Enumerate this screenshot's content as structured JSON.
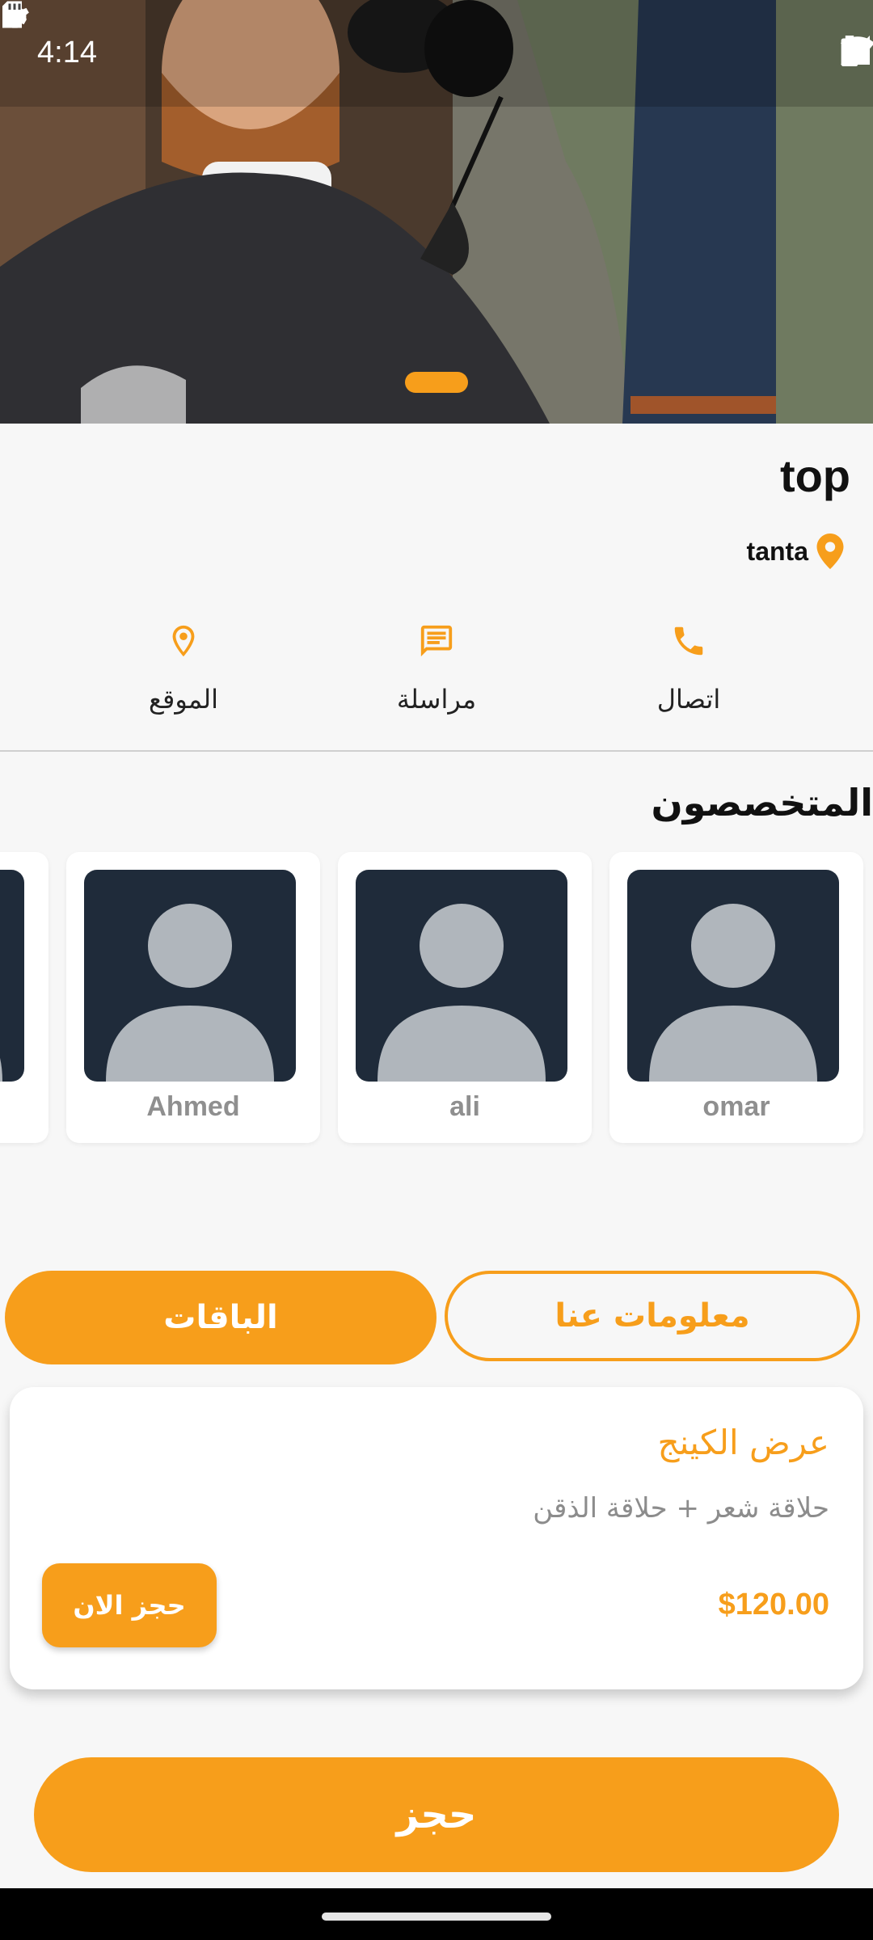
{
  "status_bar": {
    "time": "4:14",
    "icons": [
      "settings-icon",
      "sd-card-icon",
      "wifi-icon",
      "signal-icon",
      "battery-icon"
    ]
  },
  "hero": {
    "image": "barber-cutting-hair-photo",
    "pager_count": 1
  },
  "shop": {
    "name": "top",
    "location": "tanta"
  },
  "actions": [
    {
      "label": "اتصال",
      "icon": "phone-icon"
    },
    {
      "label": "مراسلة",
      "icon": "message-icon"
    },
    {
      "label": "الموقع",
      "icon": "location-pin-icon"
    }
  ],
  "specialists": {
    "title": "المتخصصون",
    "items": [
      {
        "name": "omar"
      },
      {
        "name": "ali"
      },
      {
        "name": "Ahmed"
      },
      {
        "name": ""
      }
    ]
  },
  "tabs": {
    "packages": "الباقات",
    "about": "معلومات عنا"
  },
  "package": {
    "title": "عرض الكينج",
    "description": "حلاقة شعر + حلاقة الذقن",
    "price": "$120.00",
    "book_label": "حجز الان"
  },
  "book_button": "حجز",
  "colors": {
    "accent": "#f79e1b",
    "avatar_bg": "#1f2b3a",
    "avatar_fg": "#b0b6bc"
  }
}
